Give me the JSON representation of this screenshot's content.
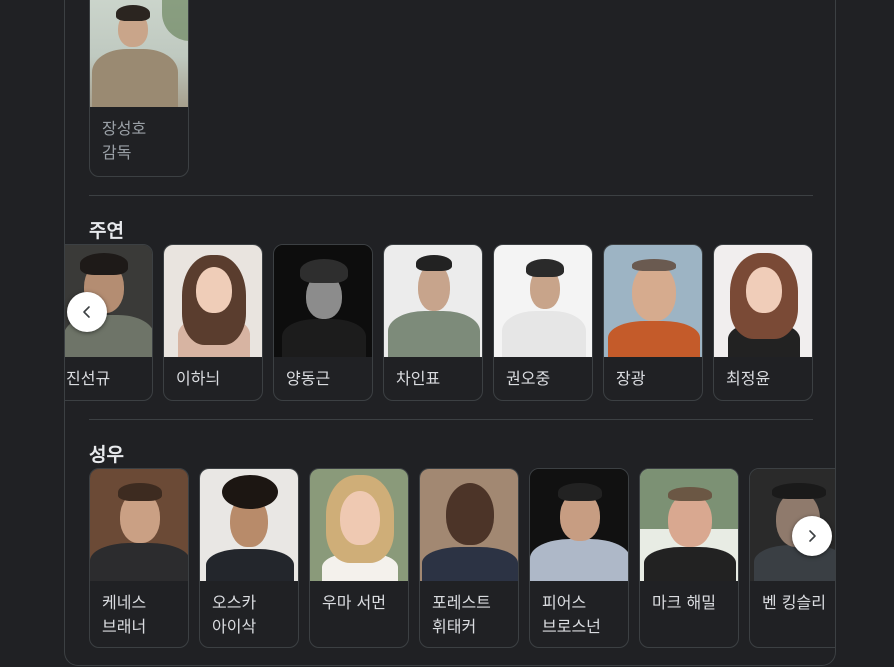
{
  "director": {
    "name": "장성호",
    "role": "감독"
  },
  "sections": {
    "cast_title": "주연",
    "voice_title": "성우"
  },
  "cast": [
    {
      "name": "진선규"
    },
    {
      "name": "이하늬"
    },
    {
      "name": "양동근"
    },
    {
      "name": "차인표"
    },
    {
      "name": "권오중"
    },
    {
      "name": "장광"
    },
    {
      "name": "최정윤"
    }
  ],
  "voice": [
    {
      "name": "케네스 브래너"
    },
    {
      "name": "오스카 아이삭"
    },
    {
      "name": "우마 서먼"
    },
    {
      "name": "포레스트 휘태커"
    },
    {
      "name": "피어스 브로스넌"
    },
    {
      "name": "마크 해밀"
    },
    {
      "name": "벤 킹슬리"
    }
  ],
  "icons": {
    "prev": "chevron-left-icon",
    "next": "chevron-right-icon"
  }
}
